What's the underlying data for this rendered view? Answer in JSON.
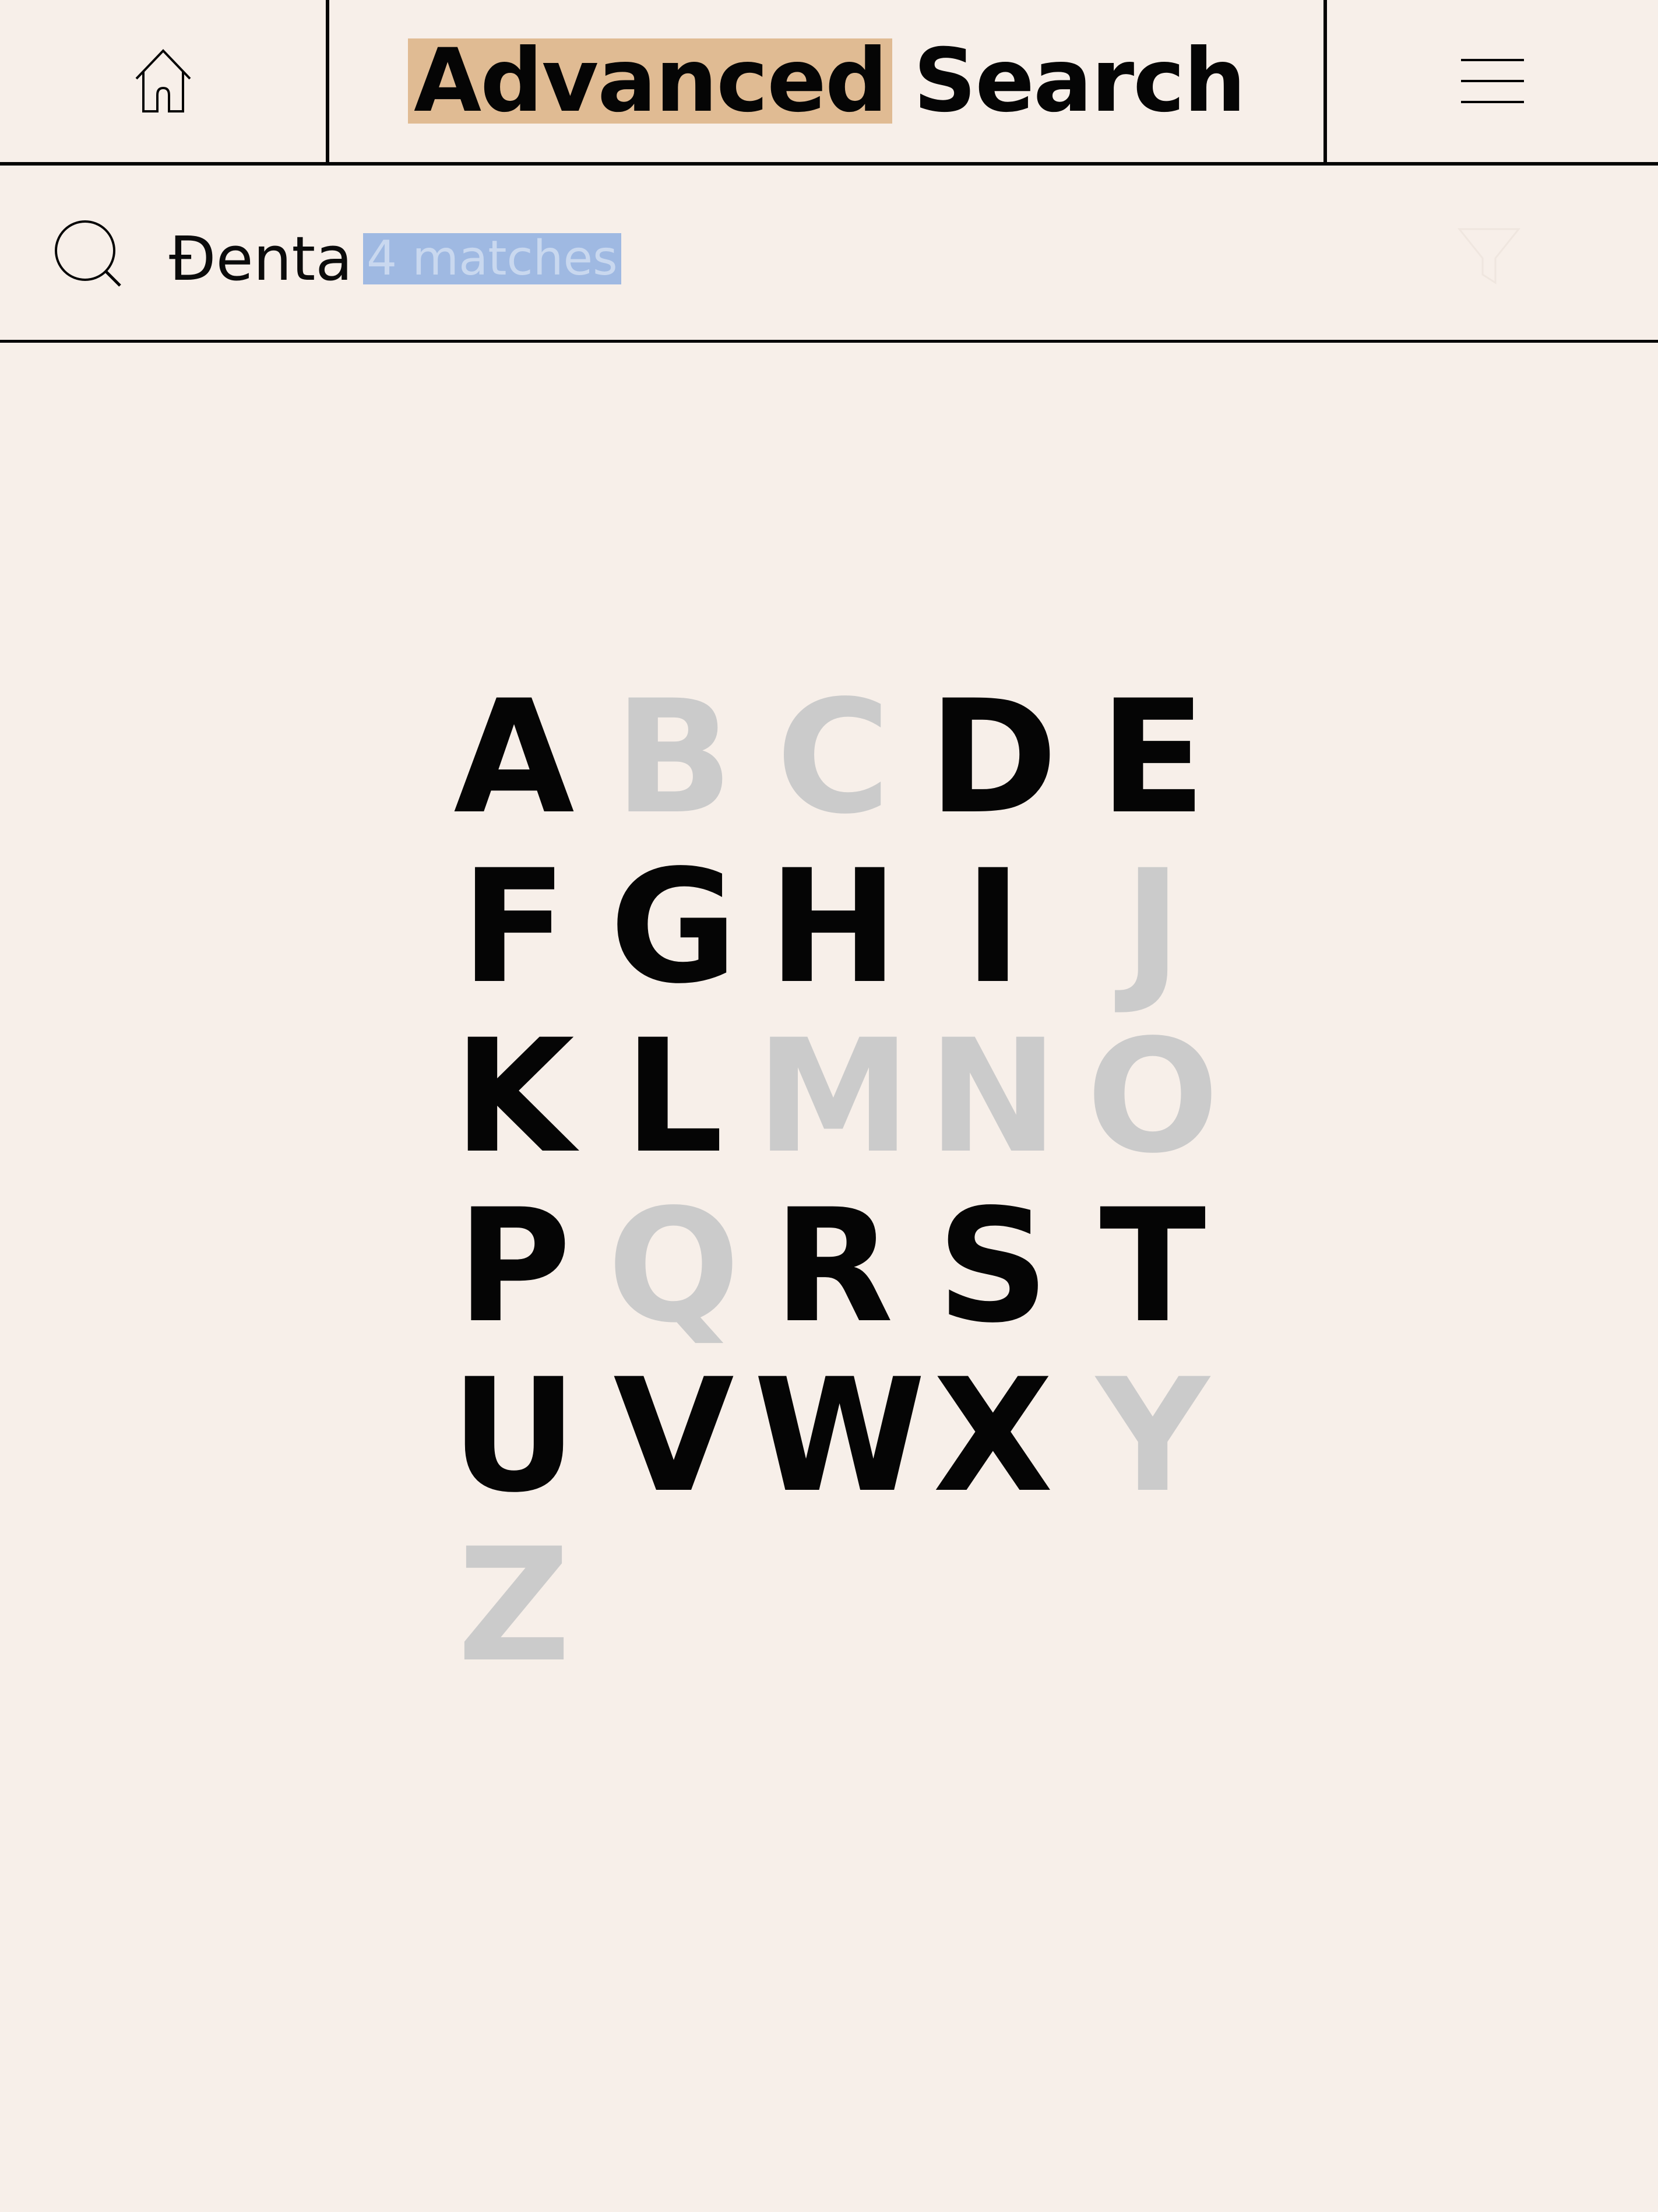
{
  "header": {
    "title_highlight": "Advanced",
    "title_rest": "Search"
  },
  "search": {
    "query": "Đenta",
    "match_hint": "4 matches"
  },
  "icons": {
    "home": "home-icon",
    "menu": "hamburger-menu-icon",
    "search": "search-icon",
    "filter": "filter-icon"
  },
  "colors": {
    "background": "#f7efe9",
    "title_highlight": "#e0bb93",
    "active_letter": "#050505",
    "inactive_letter": "#cbcbcb",
    "selection": "#9fb9e2"
  },
  "letters": [
    {
      "char": "A",
      "active": true
    },
    {
      "char": "B",
      "active": false
    },
    {
      "char": "C",
      "active": false
    },
    {
      "char": "D",
      "active": true
    },
    {
      "char": "E",
      "active": true
    },
    {
      "char": "F",
      "active": true
    },
    {
      "char": "G",
      "active": true
    },
    {
      "char": "H",
      "active": true
    },
    {
      "char": "I",
      "active": true
    },
    {
      "char": "J",
      "active": false
    },
    {
      "char": "K",
      "active": true
    },
    {
      "char": "L",
      "active": true
    },
    {
      "char": "M",
      "active": false
    },
    {
      "char": "N",
      "active": false
    },
    {
      "char": "O",
      "active": false
    },
    {
      "char": "P",
      "active": true
    },
    {
      "char": "Q",
      "active": false
    },
    {
      "char": "R",
      "active": true
    },
    {
      "char": "S",
      "active": true
    },
    {
      "char": "T",
      "active": true
    },
    {
      "char": "U",
      "active": true
    },
    {
      "char": "V",
      "active": true
    },
    {
      "char": "W",
      "active": true
    },
    {
      "char": "X",
      "active": true
    },
    {
      "char": "Y",
      "active": false
    },
    {
      "char": "Z",
      "active": false
    }
  ]
}
